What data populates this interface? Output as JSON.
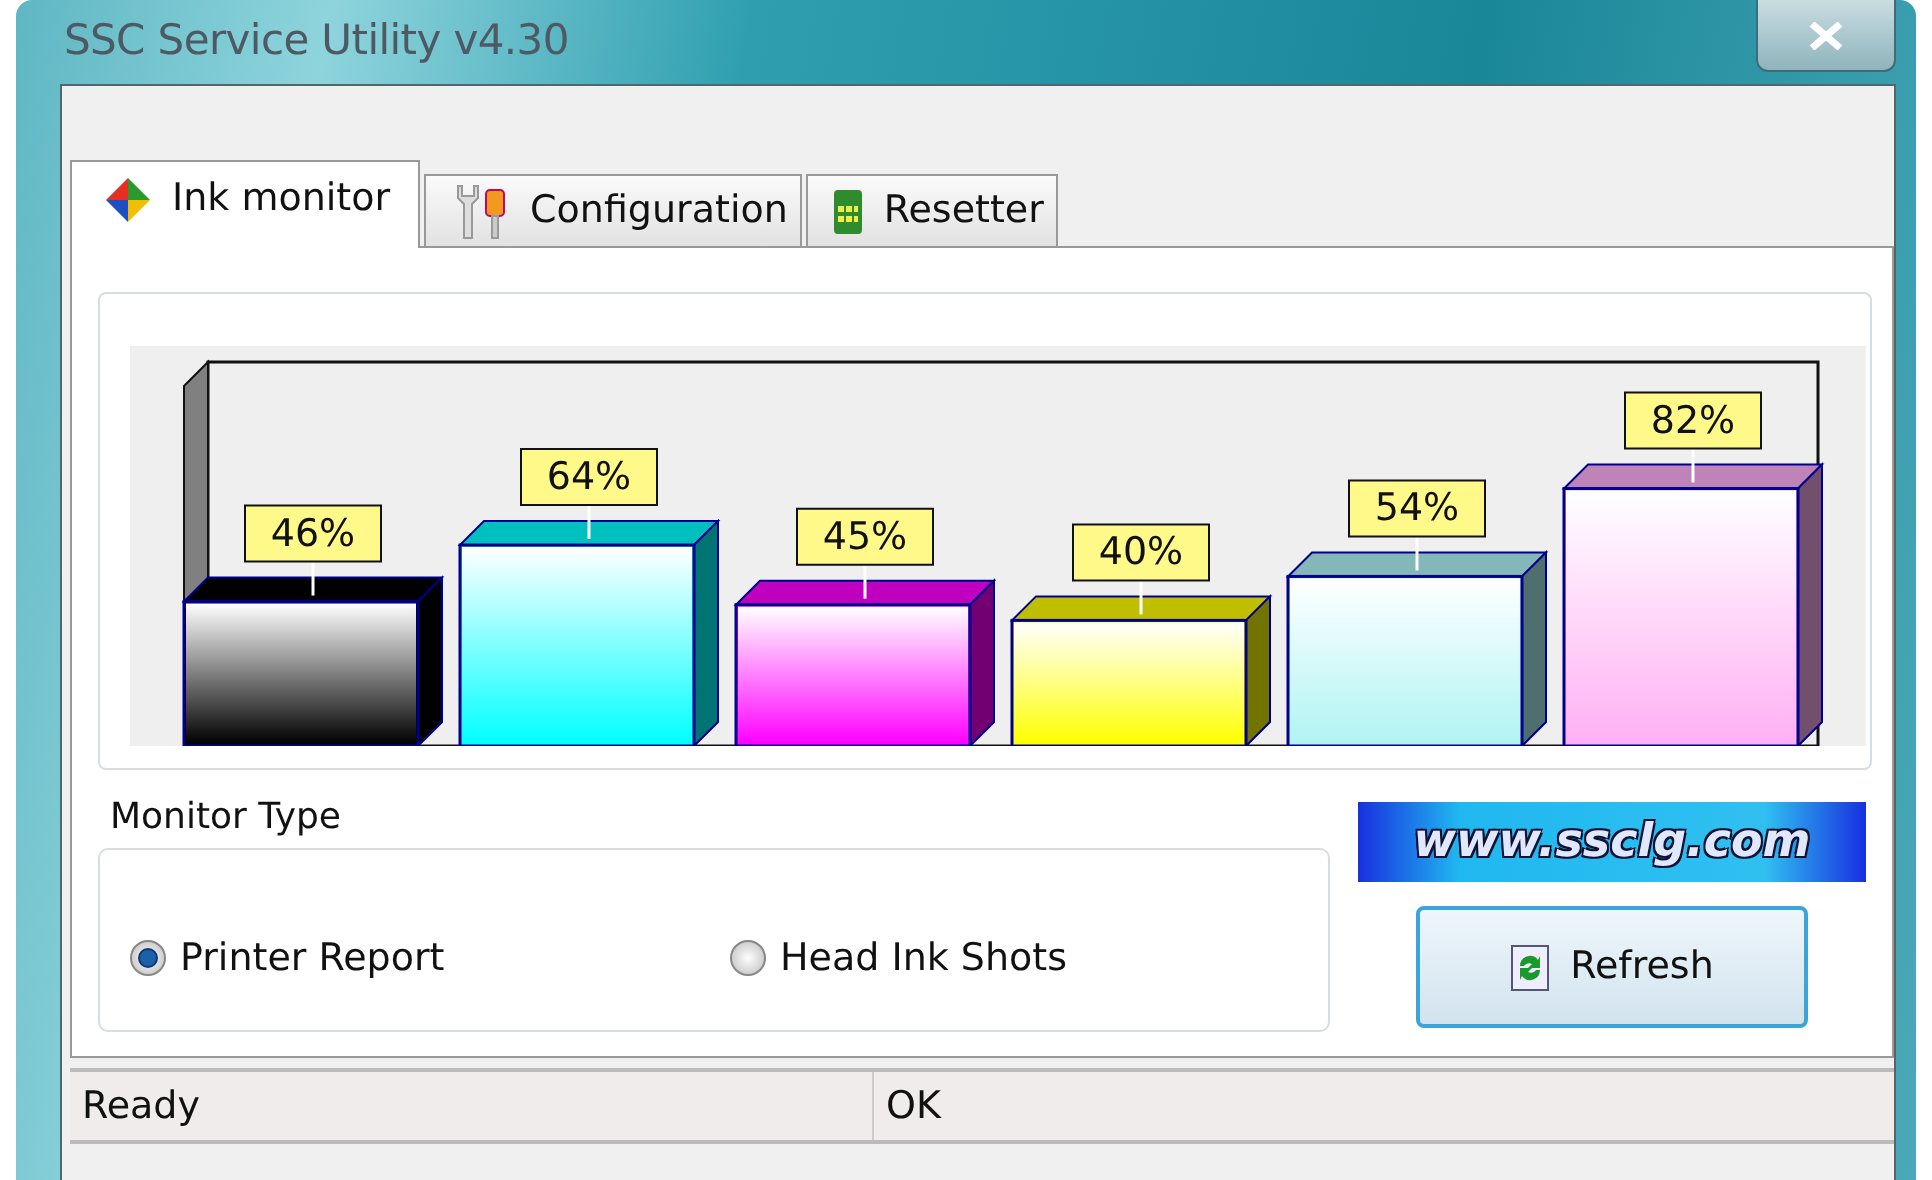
{
  "window": {
    "title": "SSC Service Utility v4.30"
  },
  "tabs": [
    {
      "label": "Ink monitor",
      "kind": "diamond",
      "selected": true
    },
    {
      "label": "Configuration",
      "kind": "tools",
      "selected": false
    },
    {
      "label": "Resetter",
      "kind": "chip",
      "selected": false
    }
  ],
  "ink_chart": {
    "chart_data": {
      "type": "bar",
      "values": [
        46,
        64,
        45,
        40,
        54,
        82
      ],
      "colors": [
        "#000000",
        "#00ffff",
        "#ff00ff",
        "#ffff00",
        "#b0f4f4",
        "#ffb0f4"
      ],
      "categories": [
        null,
        null,
        null,
        null,
        null,
        null
      ],
      "data_labels": true,
      "value_labels": [
        "46%",
        "64%",
        "45%",
        "40%",
        "54%",
        "82%"
      ]
    }
  },
  "monitor_type": {
    "label": "Monitor Type",
    "options": [
      {
        "label": "Printer Report",
        "selected": true
      },
      {
        "label": "Head Ink Shots",
        "selected": false
      }
    ]
  },
  "website_banner": "www.ssclg.com",
  "refresh_button": "Refresh",
  "status_bar": [
    "Ready",
    "OK"
  ]
}
